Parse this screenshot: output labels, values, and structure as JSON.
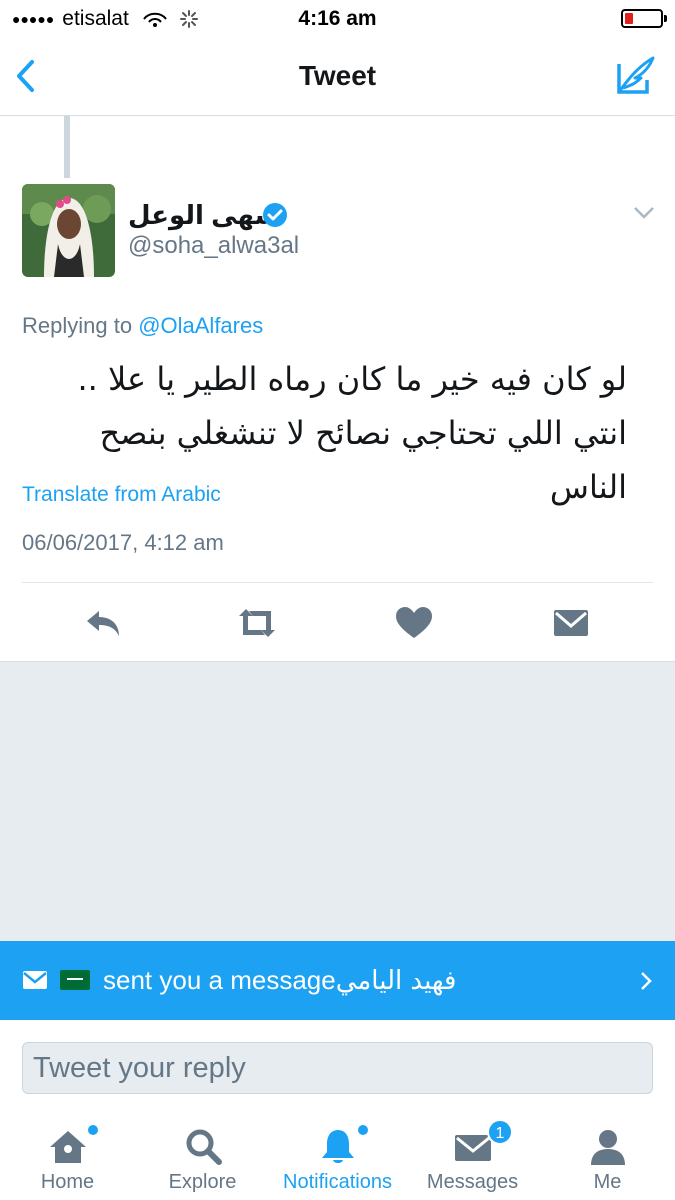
{
  "status_bar": {
    "signal_dots": "●●●●●",
    "carrier": "etisalat",
    "time": "4:16 am"
  },
  "nav": {
    "title": "Tweet"
  },
  "tweet": {
    "display_name": "سهى الوعل",
    "handle": "@soha_alwa3al",
    "replying_prefix": "Replying to ",
    "replying_to": "@OlaAlfares",
    "text": "لو كان فيه خير ما كان رماه الطير يا علا .. انتي اللي تحتاجي نصائح لا تنشغلي بنصح الناس",
    "translate_label": "Translate from Arabic",
    "timestamp": "06/06/2017, 4:12 am"
  },
  "banner": {
    "sender": "فهيد اليامي",
    "message": "sent you a message"
  },
  "reply": {
    "placeholder": "Tweet your reply"
  },
  "tabs": {
    "home": "Home",
    "explore": "Explore",
    "notifications": "Notifications",
    "messages": "Messages",
    "messages_badge": "1",
    "me": "Me"
  },
  "colors": {
    "accent": "#1da1f2",
    "muted": "#657786",
    "background_gray": "#e6ecf0"
  },
  "icons": {
    "nav": [
      "back-chevron-icon",
      "compose-tweet-icon"
    ],
    "actions": [
      "reply-icon",
      "retweet-icon",
      "like-heart-icon",
      "direct-message-icon"
    ],
    "tabs": [
      "home-icon",
      "explore-search-icon",
      "notifications-bell-icon",
      "messages-envelope-icon",
      "me-person-icon"
    ]
  }
}
